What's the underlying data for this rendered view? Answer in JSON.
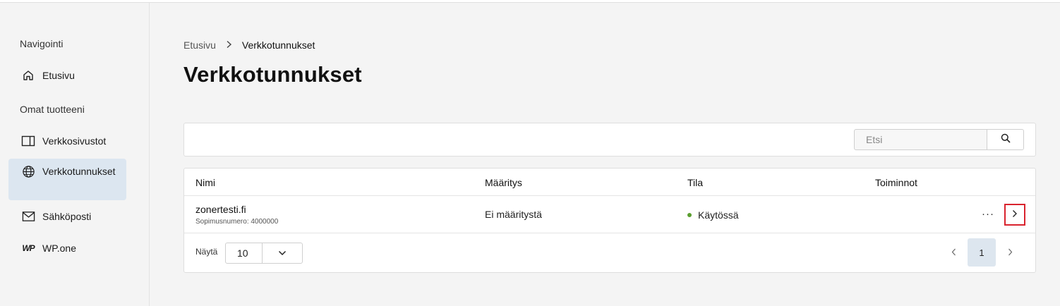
{
  "sidebar": {
    "heading_nav": "Navigointi",
    "heading_products": "Omat tuotteeni",
    "items": [
      {
        "label": "Etusivu",
        "icon": "home-icon"
      },
      {
        "label": "Verkkosivustot",
        "icon": "website-icon"
      },
      {
        "label": "Verkkotunnukset",
        "icon": "globe-icon"
      },
      {
        "label": "Sähköposti",
        "icon": "mail-icon"
      },
      {
        "label": "WP.one",
        "icon": "wp-icon"
      }
    ],
    "wp_logo_text": "WP"
  },
  "breadcrumb": {
    "home": "Etusivu",
    "separator": ">",
    "current": "Verkkotunnukset"
  },
  "page": {
    "title": "Verkkotunnukset"
  },
  "search": {
    "placeholder": "Etsi"
  },
  "table": {
    "columns": [
      "Nimi",
      "Määritys",
      "Tila",
      "Toiminnot"
    ],
    "rows": [
      {
        "name": "zonertesti.fi",
        "contract": "Sopimusnumero: 4000000",
        "config": "Ei määritystä",
        "status": "Käytössä",
        "status_color": "#5a9e2f",
        "more": "···"
      }
    ]
  },
  "pagination": {
    "show_label": "Näytä",
    "page_size": "10",
    "current_page": "1"
  },
  "colors": {
    "active_nav": "#dce6f0",
    "highlight": "#d9232e"
  }
}
